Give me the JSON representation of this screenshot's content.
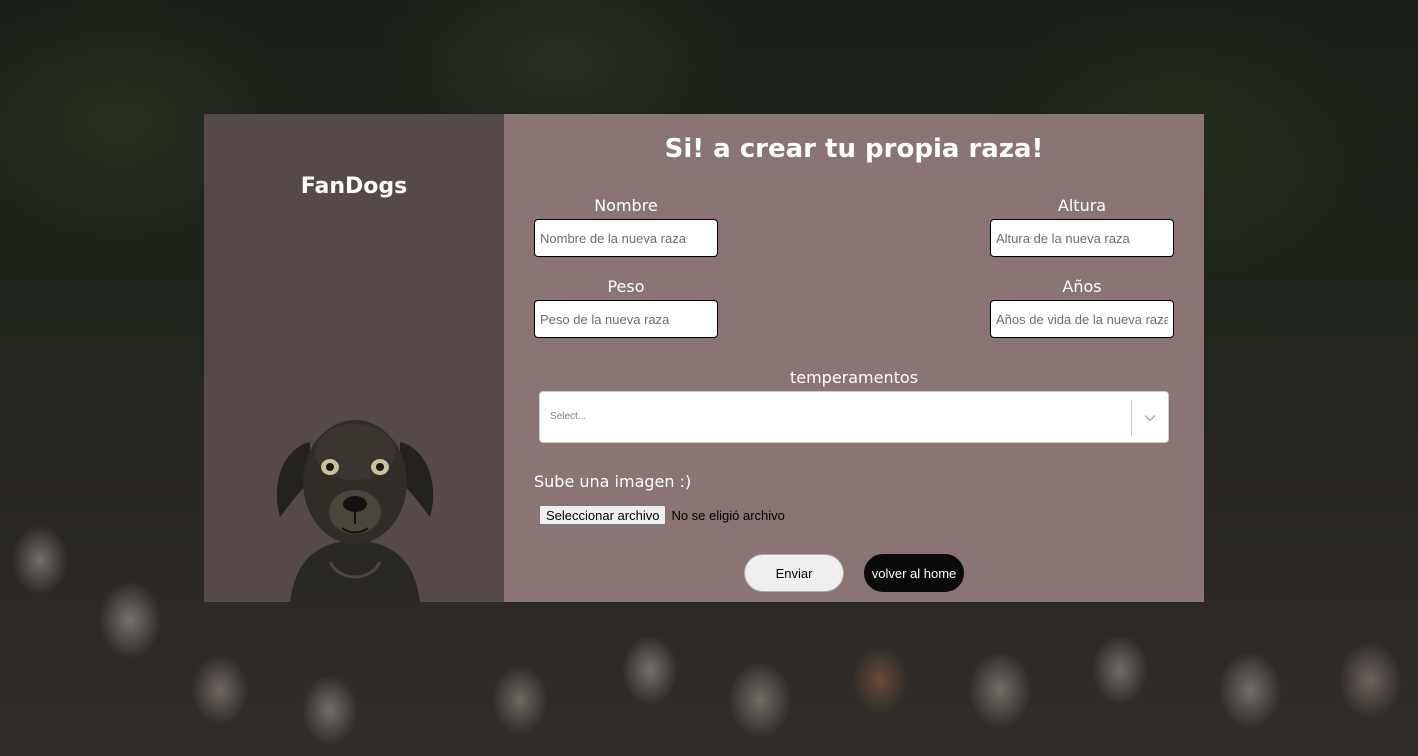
{
  "brand": {
    "name": "FanDogs"
  },
  "form": {
    "title": "Si! a crear tu propia raza!",
    "nombre": {
      "label": "Nombre",
      "placeholder": "Nombre de la nueva raza"
    },
    "altura": {
      "label": "Altura",
      "placeholder": "Altura de la nueva raza"
    },
    "peso": {
      "label": "Peso",
      "placeholder": "Peso de la nueva raza"
    },
    "anos": {
      "label": "Años",
      "placeholder": "Años de vida de la nueva raza"
    },
    "temperamentos": {
      "label": "temperamentos",
      "placeholder": "Select..."
    },
    "imagen": {
      "label": "Sube una imagen :)",
      "button_label": "Seleccionar archivo",
      "status": "No se eligió archivo"
    },
    "submit_label": "Enviar",
    "home_label": "volver al home"
  },
  "colors": {
    "sidebar": "#564a49",
    "panel": "#8a7574",
    "home_button": "#0a0a0a"
  },
  "icons": {
    "select_indicator": "chevron-down-icon"
  }
}
